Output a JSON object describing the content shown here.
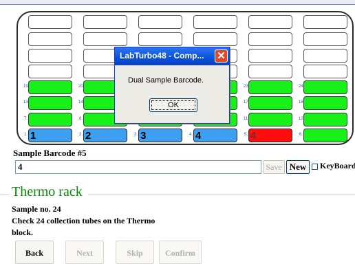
{
  "rack": {
    "slot_numbers": [
      "19.",
      "20.",
      "23.",
      "24.",
      "13.",
      "14.",
      "17.",
      "18.",
      "7.",
      "8.",
      "11.",
      "12.",
      "1.",
      "2.",
      "3.",
      "4.",
      "5.",
      "6."
    ],
    "slot_values": [
      "1",
      "2",
      "3",
      "4",
      "4"
    ],
    "colors": {
      "green": "#19f019",
      "blue": "#3d9ff0",
      "red": "#ff0d0d",
      "empty": "#ffffff"
    }
  },
  "dialog": {
    "title": "LabTurbo48 - Comp...",
    "message": "Dual Sample Barcode.",
    "ok_label": "OK",
    "close_icon": "close-icon"
  },
  "barcode": {
    "label": "Sample Barcode #5",
    "value": "4",
    "save_label": "Save",
    "new_label": "New",
    "keyboard_label": "KeyBoard"
  },
  "thermo": {
    "title": "Thermo rack",
    "sample_no": "Sample no. 24",
    "instruction_line1": "Check 24 collection tubes on the Thermo",
    "instruction_line2": "block."
  },
  "buttons": {
    "back": "Back",
    "next": "Next",
    "skip": "Skip",
    "confirm": "Confirm"
  }
}
